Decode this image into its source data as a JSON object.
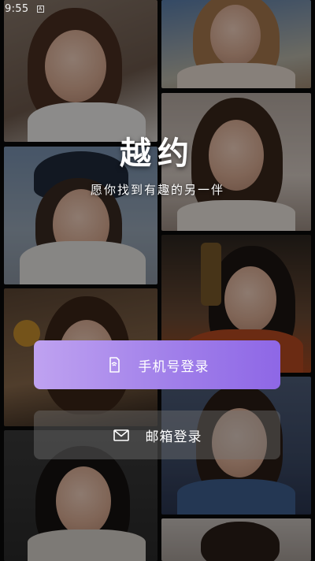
{
  "status_bar": {
    "time": "9:55",
    "indicator": "A"
  },
  "brand": {
    "title": "越约",
    "slogan": "愿你找到有趣的另一伴"
  },
  "login": {
    "phone": {
      "label": "手机号登录",
      "icon": "phone-icon"
    },
    "email": {
      "label": "邮箱登录",
      "icon": "mail-icon"
    }
  },
  "colors": {
    "accent_gradient": [
      "#bfa2f0",
      "#8e67e6"
    ],
    "secondary_button": "#787878",
    "background": "#0a0a0a"
  }
}
